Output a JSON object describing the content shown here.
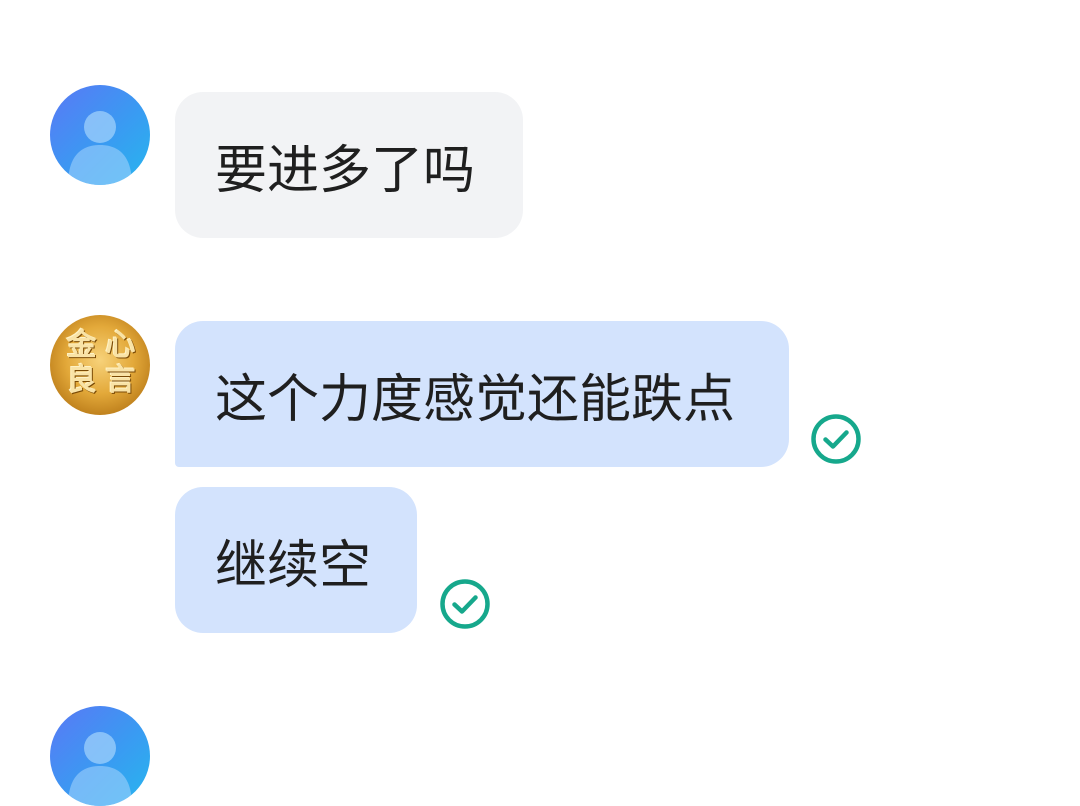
{
  "colors": {
    "bubble_gray": "#f2f3f5",
    "bubble_blue": "#d3e3fd",
    "text": "#1f1f1f",
    "check": "#16a88c"
  },
  "messages": [
    {
      "sender": "contact",
      "avatar_icon": "person-icon",
      "text": "要进多了吗"
    },
    {
      "sender": "self",
      "avatar_lettering": [
        "金",
        "心",
        "良",
        "言"
      ],
      "bubbles": [
        {
          "text": "这个力度感觉还能跌点",
          "status_icon": "check-circle-icon"
        },
        {
          "text": "继续空",
          "status_icon": "check-circle-icon"
        }
      ]
    },
    {
      "sender": "contact",
      "avatar_icon": "person-icon"
    }
  ]
}
